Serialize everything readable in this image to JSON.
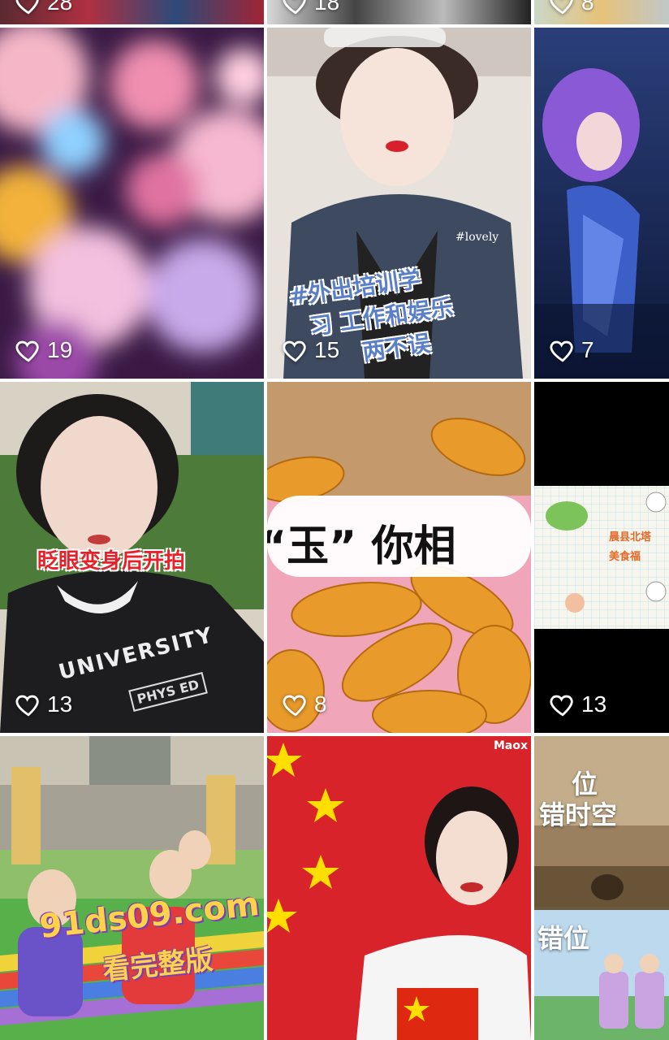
{
  "grid": {
    "top_row": [
      {
        "likes": "28"
      },
      {
        "likes": "18"
      },
      {
        "likes": "8"
      }
    ],
    "tiles": [
      {
        "likes": "19"
      },
      {
        "likes": "15",
        "caption_lines": [
          "#外出培训学",
          "习 工作和娱乐",
          "两不误"
        ],
        "tag": "#lovely"
      },
      {
        "likes": "7"
      },
      {
        "likes": "13",
        "caption": "眨眼变身后开拍",
        "shirt_text": "UNIVERSITY",
        "patch_text": "PHYS ED"
      },
      {
        "likes": "8",
        "caption": "“玉” 你相"
      },
      {
        "likes": "13",
        "mini_lines": [
          "晨县北塔",
          "美食福"
        ]
      },
      {
        "likes": ""
      },
      {
        "likes": "",
        "badge": "Maox"
      },
      {
        "likes": "",
        "upper_text_lines": [
          "位",
          "错时空"
        ],
        "lower_text": "错位"
      }
    ]
  },
  "watermark": {
    "domain": "91ds09.com",
    "cta": "看完整版"
  },
  "colors": {
    "like_text": "#ffffff",
    "caption_red": "#e8202a",
    "watermark_gold": "#ffd24a",
    "watermark_outline": "#7a3fb0"
  }
}
